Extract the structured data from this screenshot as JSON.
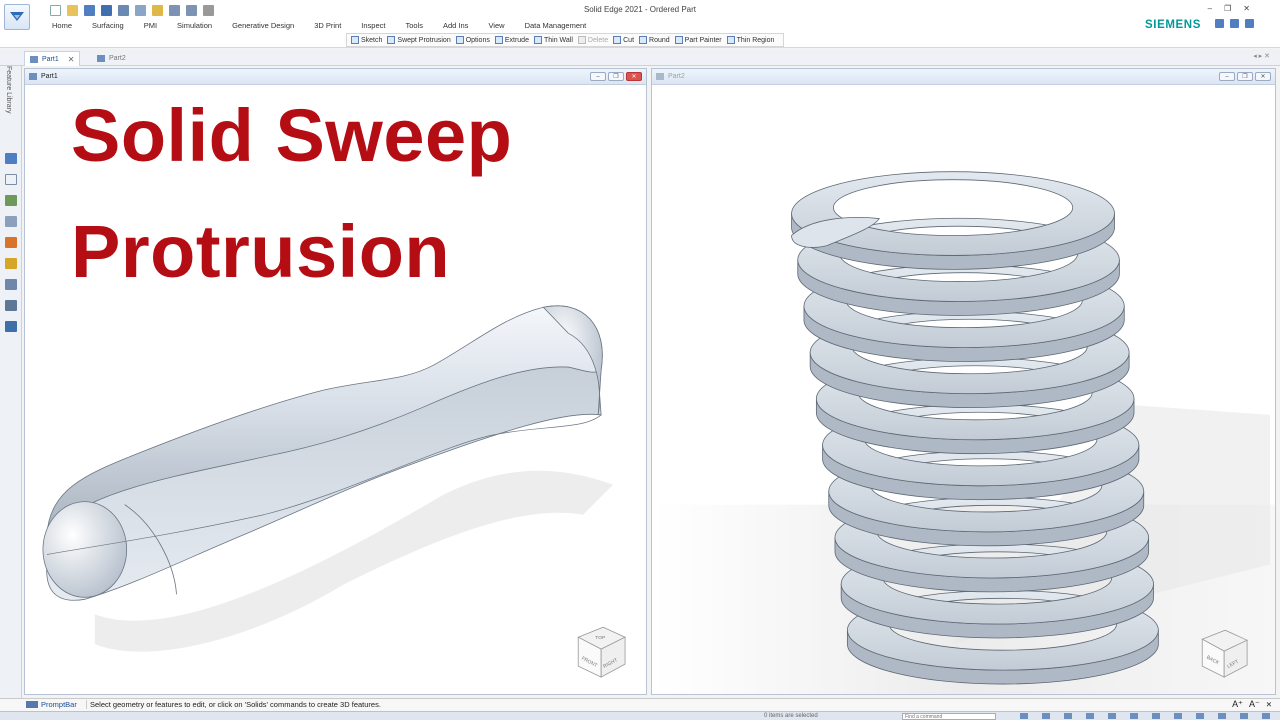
{
  "app": {
    "window_title": "Solid Edge 2021 - Ordered Part",
    "brand": "SIEMENS"
  },
  "ribbon": {
    "tabs": [
      "Home",
      "Surfacing",
      "PMI",
      "Simulation",
      "Generative Design",
      "3D Print",
      "Inspect",
      "Tools",
      "Add Ins",
      "View",
      "Data Management"
    ],
    "commands": [
      {
        "label": "Sketch",
        "enabled": true
      },
      {
        "label": "Swept Protrusion",
        "enabled": true
      },
      {
        "label": "Options",
        "enabled": true
      },
      {
        "label": "Extrude",
        "enabled": true
      },
      {
        "label": "Thin Wall",
        "enabled": true
      },
      {
        "label": "Delete",
        "enabled": false
      },
      {
        "label": "Cut",
        "enabled": true
      },
      {
        "label": "Round",
        "enabled": true
      },
      {
        "label": "Part Painter",
        "enabled": true
      },
      {
        "label": "Thin Region",
        "enabled": true
      }
    ]
  },
  "doc_tabs": {
    "tab1": "Part1",
    "tab2": "Part2"
  },
  "side_pane": {
    "label": "Feature Library"
  },
  "windows": {
    "left_title": "Part1",
    "right_title": "Part2"
  },
  "overlay": {
    "line1": "Solid Sweep",
    "line2": "Protrusion"
  },
  "view_cubes": {
    "left": {
      "top": "TOP",
      "front": "FRONT",
      "right": "RIGHT"
    },
    "right": {
      "back": "BACK",
      "left": "LEFT"
    }
  },
  "status": {
    "prompt_label": "PromptBar",
    "prompt_text": "Select geometry or features to edit, or click on 'Solids' commands to create 3D features.",
    "selection_text": "0 items are selected",
    "find_placeholder": "Find a command"
  },
  "colors": {
    "headline": "#b50d14",
    "brand": "#009999",
    "model": "#c9d2dc"
  }
}
